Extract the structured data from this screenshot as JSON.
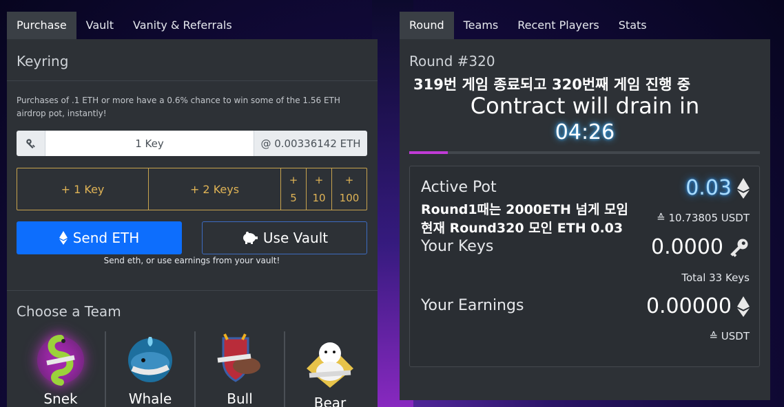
{
  "left_tabs": [
    "Purchase",
    "Vault",
    "Vanity & Referrals"
  ],
  "right_tabs": [
    "Round",
    "Teams",
    "Recent Players",
    "Stats"
  ],
  "purchase": {
    "title": "Keyring",
    "airdrop_text": "Purchases of .1 ETH or more have a 0.6% chance to win some of the 1.56 ETH airdrop pot, instantly!",
    "key_input_value": "1 Key",
    "price": "@ 0.00336142 ETH",
    "add_buttons": [
      "+ 1 Key",
      "+ 2 Keys"
    ],
    "small_add": [
      {
        "plus": "+",
        "num": "5"
      },
      {
        "plus": "+",
        "num": "10"
      },
      {
        "plus": "+",
        "num": "100"
      }
    ],
    "send_label": "Send ETH",
    "vault_label": "Use Vault",
    "hint": "Send eth, or use earnings from your vault!",
    "team_title": "Choose a Team",
    "teams": [
      "Snek",
      "Whale",
      "Bull",
      "Bear"
    ]
  },
  "round": {
    "title": "Round #320",
    "note1": "319번 게임 종료되고 320번째 게임 진행 중",
    "drain_text": "Contract will drain in",
    "timer": "04:26",
    "progress": 0.11,
    "active_pot_label": "Active Pot",
    "active_pot_value": "0.03",
    "active_pot_usd": "≙ 10.73805 USDT",
    "note2": "Round1때는 2000ETH 넘게 모임",
    "note3": "현재 Round320 모인 ETH 0.03",
    "your_keys_label": "Your Keys",
    "your_keys_value": "0.0000",
    "total_keys": "Total 33 Keys",
    "earnings_label": "Your Earnings",
    "earnings_value": "0.00000",
    "earnings_usd": "≙ USDT"
  },
  "colors": {
    "accent_blue": "#0d6efd",
    "gold": "#e0b456",
    "panel": "#2d3136",
    "progress": "#c03bd6"
  }
}
